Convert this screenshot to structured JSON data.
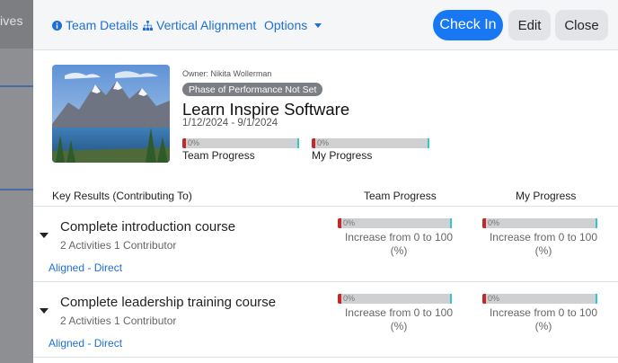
{
  "background": {
    "fragment_text": "ives"
  },
  "toolbar": {
    "team_details": "Team Details",
    "vertical_alignment": "Vertical Alignment",
    "options": "Options",
    "check_in": "Check In",
    "edit": "Edit",
    "close": "Close"
  },
  "objective": {
    "owner": "Owner: Nikita Wollerman",
    "phase": "Phase of Performance Not Set",
    "title": "Learn Inspire Software",
    "dates": "1/12/2024 - 9/1/2024",
    "team_progress": {
      "label": "Team Progress",
      "pct_text": "0%",
      "value": 0
    },
    "my_progress": {
      "label": "My Progress",
      "pct_text": "0%",
      "value": 0
    }
  },
  "table": {
    "headers": {
      "key_results": "Key Results (Contributing To)",
      "team_progress": "Team Progress",
      "my_progress": "My Progress"
    },
    "rows": [
      {
        "title": "Complete introduction course",
        "subtitle": "2 Activities 1 Contributor",
        "aligned": "Aligned - Direct",
        "team": {
          "pct_text": "0%",
          "line1": "Increase from 0 to 100",
          "line2": "(%)"
        },
        "mine": {
          "pct_text": "0%",
          "line1": "Increase from 0 to 100",
          "line2": "(%)"
        }
      },
      {
        "title": "Complete leadership training course",
        "subtitle": "2 Activities 1 Contributor",
        "aligned": "Aligned - Direct",
        "team": {
          "pct_text": "0%",
          "line1": "Increase from 0 to 100",
          "line2": "(%)"
        },
        "mine": {
          "pct_text": "0%",
          "line1": "Increase from 0 to 100",
          "line2": "(%)"
        }
      }
    ]
  },
  "colors": {
    "accent": "#1877f2",
    "link": "#1f6fd6",
    "progress_start": "#c62828",
    "progress_end": "#30c8d0",
    "progress_track": "#cfd0d2",
    "phase_badge": "#7b7e83"
  }
}
